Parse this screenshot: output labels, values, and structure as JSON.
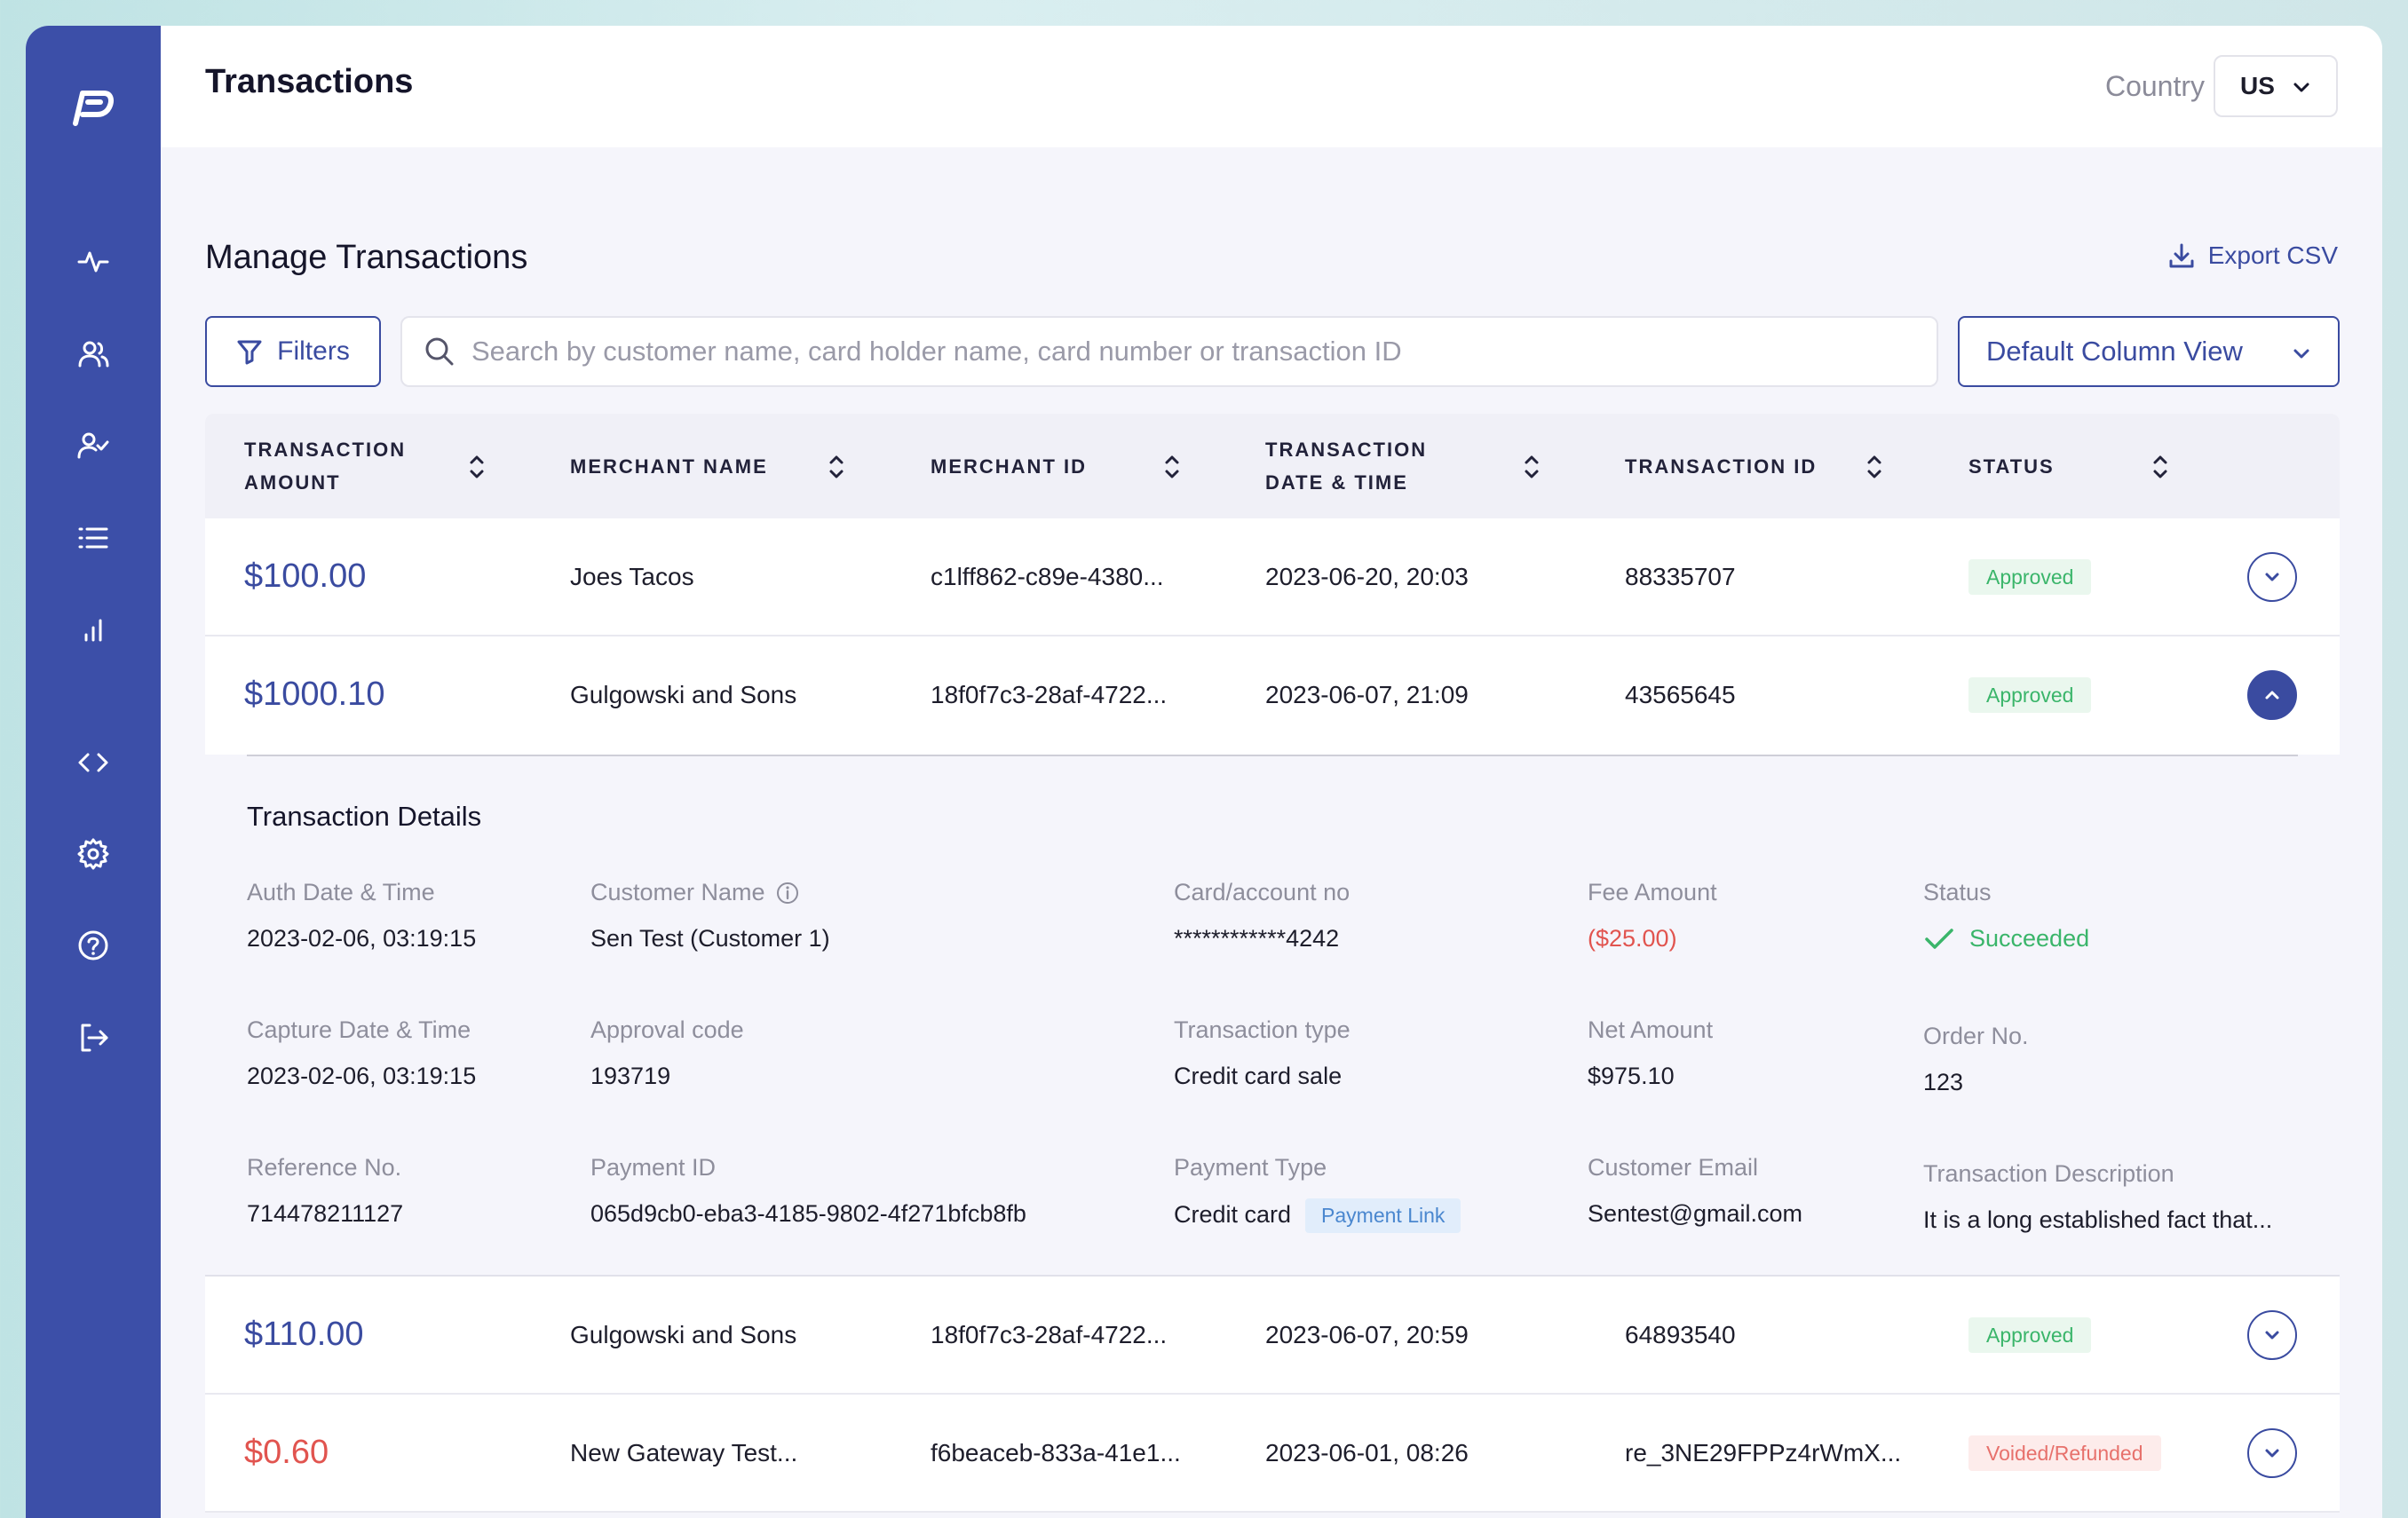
{
  "app": {
    "page_title": "Transactions",
    "country_label": "Country",
    "country_value": "US"
  },
  "sidebar": {
    "items": [
      {
        "icon": "activity-icon"
      },
      {
        "icon": "users-icon"
      },
      {
        "icon": "user-check-icon"
      },
      {
        "icon": "list-icon"
      },
      {
        "icon": "bar-chart-icon"
      },
      {
        "icon": "code-icon"
      },
      {
        "icon": "gear-icon"
      },
      {
        "icon": "help-icon"
      },
      {
        "icon": "logout-icon"
      }
    ]
  },
  "main": {
    "section_title": "Manage Transactions",
    "export_label": "Export CSV",
    "filters_label": "Filters",
    "search_placeholder": "Search by customer name, card holder name, card number or transaction ID",
    "column_view_label": "Default Column View"
  },
  "table": {
    "columns": [
      {
        "line1": "TRANSACTION",
        "line2": "AMOUNT"
      },
      {
        "line1": "MERCHANT NAME",
        "line2": ""
      },
      {
        "line1": "MERCHANT ID",
        "line2": ""
      },
      {
        "line1": "TRANSACTION",
        "line2": "DATE & TIME"
      },
      {
        "line1": "TRANSACTION ID",
        "line2": ""
      },
      {
        "line1": "STATUS",
        "line2": ""
      }
    ],
    "rows": [
      {
        "amount": "$100.00",
        "merchant": "Joes Tacos",
        "merchant_id": "c1lff862-c89e-4380...",
        "datetime": "2023-06-20, 20:03",
        "txn_id": "88335707",
        "status": "Approved"
      },
      {
        "amount": "$1000.10",
        "merchant": "Gulgowski and Sons",
        "merchant_id": "18f0f7c3-28af-4722...",
        "datetime": "2023-06-07, 21:09",
        "txn_id": "43565645",
        "status": "Approved"
      },
      {
        "amount": "$110.00",
        "merchant": "Gulgowski and Sons",
        "merchant_id": "18f0f7c3-28af-4722...",
        "datetime": "2023-06-07, 20:59",
        "txn_id": "64893540",
        "status": "Approved"
      },
      {
        "amount": "$0.60",
        "merchant": "New Gateway Test...",
        "merchant_id": "f6beaceb-833a-41e1...",
        "datetime": "2023-06-01, 08:26",
        "txn_id": "re_3NE29FPPz4rWmX...",
        "status": "Voided/Refunded"
      }
    ]
  },
  "details": {
    "title": "Transaction Details",
    "auth_label": "Auth Date & Time",
    "auth_value": "2023-02-06, 03:19:15",
    "customer_label": "Customer Name",
    "customer_value": "Sen Test (Customer 1)",
    "card_label": "Card/account no",
    "card_value": "************4242",
    "fee_label": "Fee Amount",
    "fee_value": "($25.00)",
    "status_label": "Status",
    "status_value": "Succeeded",
    "capture_label": "Capture Date & Time",
    "capture_value": "2023-02-06, 03:19:15",
    "approval_label": "Approval code",
    "approval_value": "193719",
    "txn_type_label": "Transaction type",
    "txn_type_value": "Credit card sale",
    "net_label": "Net Amount",
    "net_value": "$975.10",
    "order_label": "Order No.",
    "order_value": "123",
    "ref_label": "Reference No.",
    "ref_value": "714478211127",
    "payment_id_label": "Payment ID",
    "payment_id_value": "065d9cb0-eba3-4185-9802-4f271bfcb8fb",
    "payment_type_label": "Payment Type",
    "payment_type_value": "Credit card",
    "payment_link_label": "Payment Link",
    "email_label": "Customer Email",
    "email_value": "Sentest@gmail.com",
    "desc_label": "Transaction Description",
    "desc_value": "It is a long established fact that..."
  }
}
